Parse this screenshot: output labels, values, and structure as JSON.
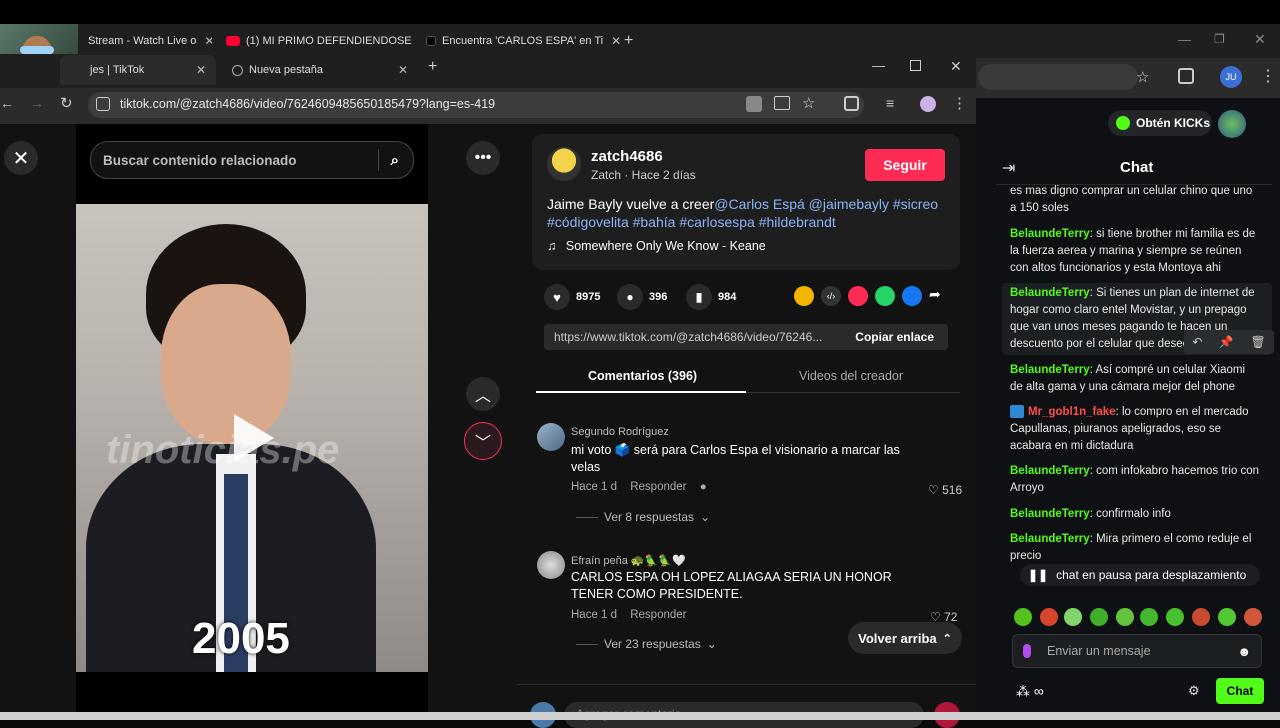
{
  "back_window": {
    "tabs": [
      {
        "label": "Stream - Watch Live o"
      },
      {
        "label": "(1) MI PRIMO DEFENDIENDOSE"
      },
      {
        "label": "Encuentra 'CARLOS ESPA' en Ti"
      }
    ],
    "profile_initials": "JU",
    "kick": {
      "get_kicks_label": "Obtén KICKs",
      "chat_title": "Chat",
      "paused_label": "chat en pausa para desplazamiento",
      "message_placeholder": "Enviar un mensaje",
      "chat_button_label": "Chat",
      "messages": [
        {
          "user": "",
          "text": "es mas digno comprar un celular chino que uno a 150 soles"
        },
        {
          "user": "BelaundeTerry",
          "text": "si tiene brother mi familia es de la fuerza aerea y marina y siempre se reúnen con altos funcionarios y esta Montoya ahi"
        },
        {
          "user": "BelaundeTerry",
          "text": "Si tienes un plan de internet de hogar como claro entel Movistar, y un prepago que van unos meses pagando te hacen un descuento por el celular que desees"
        },
        {
          "user": "BelaundeTerry",
          "text": "Así compré un celular Xiaomi de alta gama y una cámara mejor del phone"
        },
        {
          "user": "Mr_gobl1n_fake",
          "text": "lo compro en el mercado Capullanas, piuranos apeligrados, eso se acabara en mi dictadura"
        },
        {
          "user": "BelaundeTerry",
          "text": "com infokabro hacemos trio con Arroyo"
        },
        {
          "user": "BelaundeTerry",
          "text": "confirmalo info"
        },
        {
          "user": "BelaundeTerry",
          "text": "Mira primero el como reduje el precio"
        }
      ]
    }
  },
  "front_window": {
    "tabs": [
      {
        "label": "jes | TikTok"
      },
      {
        "label": "Nueva pestaña"
      }
    ],
    "url": "tiktok.com/@zatch4686/video/7624609485650185479?lang=es-419",
    "search_placeholder": "Buscar contenido relacionado",
    "video_overlay_text": "2005",
    "video_watermark": "tinoticias.pe",
    "author": {
      "username": "zatch4686",
      "subtitle": "Zatch · Hace 2 días",
      "follow_label": "Seguir"
    },
    "caption": {
      "text": "Jaime Bayly vuelve a creer",
      "tags": "@Carlos Espá @jaimebayly #sicreo #códigovelita #bahía #carlosespa #hildebrandt"
    },
    "music": "Somewhere Only We Know - Keane",
    "stats": {
      "likes": "8975",
      "comments": "396",
      "saves": "984"
    },
    "link": {
      "url": "https://www.tiktok.com/@zatch4686/video/76246...",
      "copy_label": "Copiar enlace"
    },
    "tabs_panel": {
      "comments": "Comentarios (396)",
      "creator": "Videos del creador"
    },
    "comments": [
      {
        "user": "Segundo Rodríguez",
        "text": "mi voto 🗳️ será para Carlos Espa el visionario a marcar las velas",
        "time": "Hace 1 d",
        "reply": "Responder",
        "likes": "516",
        "more": "Ver 8 respuestas"
      },
      {
        "user": "Efraín peña 🐢🦜🦜🤍",
        "text": "CARLOS ESPA OH LOPEZ ALIAGAA SERIA UN HONOR TENER COMO PRESIDENTE.",
        "time": "Hace 1 d",
        "reply": "Responder",
        "likes": "72",
        "more": "Ver 23 respuestas"
      }
    ],
    "back_to_top": "Volver arriba",
    "add_comment_placeholder": "Agregar comentario..."
  }
}
